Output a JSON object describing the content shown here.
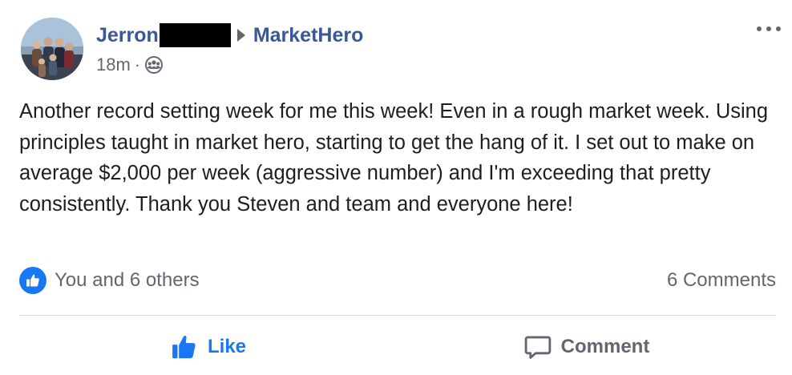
{
  "post": {
    "author_name": "Jerron",
    "group_name": "MarketHero",
    "timestamp": "18m",
    "separator": "·",
    "audience_icon": "group-icon",
    "more_icon": "more-options-icon",
    "text": "Another record setting week for me this week! Even in a rough market week. Using principles taught in market hero, starting to get the hang of it. I set out to make on average $2,000 per week (aggressive number) and I'm exceeding that pretty consistently. Thank you Steven and team and everyone here!",
    "reactions": {
      "icon": "like-badge-icon",
      "label": "You and 6 others"
    },
    "comments_count": "6 Comments",
    "actions": {
      "like_label": "Like",
      "comment_label": "Comment"
    }
  },
  "colors": {
    "link": "#385898",
    "like_blue": "#1877f2",
    "secondary_text": "#606770",
    "body_text": "#1c1e21",
    "divider": "#dadde1"
  }
}
